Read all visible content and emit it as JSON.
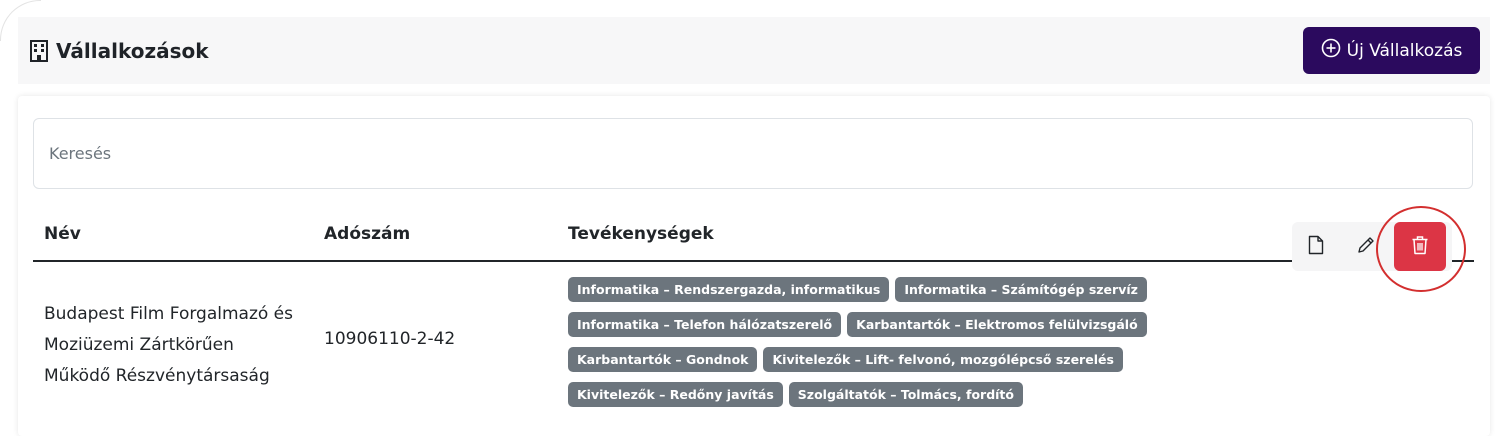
{
  "header": {
    "title": "Vállalkozások",
    "title_icon": "building-icon",
    "new_button_label": "Új Vállalkozás",
    "new_button_icon": "plus-circle-icon",
    "new_button_color": "#2b0a5e"
  },
  "search": {
    "placeholder": "Keresés",
    "value": ""
  },
  "table": {
    "columns": [
      "Név",
      "Adószám",
      "Tevékenységek"
    ],
    "rows": [
      {
        "name_lines": [
          "Budapest Film Forgalmazó és",
          "Moziüzemi Zártkörűen",
          "Működő Részvénytársaság"
        ],
        "tax_number": "10906110-2-42",
        "activities": [
          [
            "Informatika – Rendszergazda, informatikus",
            "Informatika – Számítógép szervíz"
          ],
          [
            "Informatika – Telefon hálózatszerelő",
            "Karbantartók – Elektromos felülvizsgáló"
          ],
          [
            "Karbantartók – Gondnok",
            "Kivitelezők – Lift- felvonó, mozgólépcső szerelés"
          ],
          [
            "Kivitelezők – Redőny javítás",
            "Szolgáltatók – Tolmács, fordító"
          ]
        ],
        "actions": [
          "file-icon",
          "pencil-icon",
          "trash-icon"
        ]
      }
    ]
  },
  "colors": {
    "tag_bg": "#6c757d",
    "delete_bg": "#dc3545",
    "highlight": "#d32f2f"
  }
}
